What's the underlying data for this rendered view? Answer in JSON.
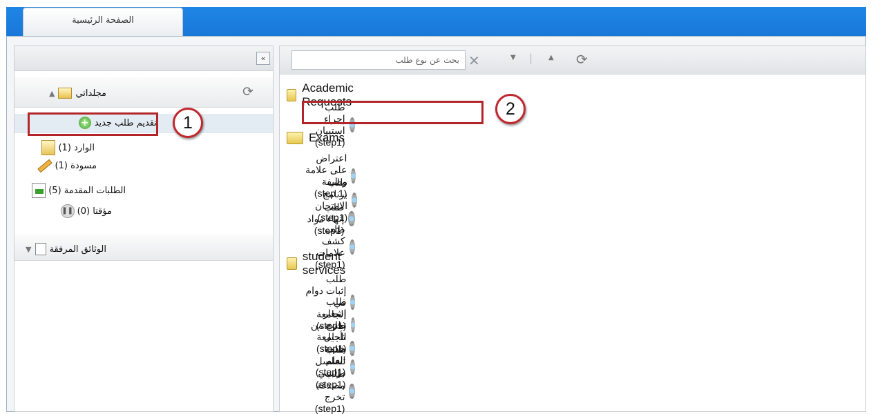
{
  "window": {
    "tab_label": "الصفحة الرئيسية"
  },
  "left_panel": {
    "collapse_glyph": "«",
    "my_folders": {
      "title": "مجلداتي",
      "items": [
        {
          "label": "تقديم طلب جديد"
        },
        {
          "label": "الوارد (1)"
        },
        {
          "label": "مسودة (1)"
        },
        {
          "label": "الطلبات المقدمة (5)"
        },
        {
          "label": "مؤقتا (0)"
        }
      ]
    },
    "attachments": {
      "title": "الوثائق المرفقة"
    }
  },
  "search": {
    "placeholder": "بحث عن نوع طلب"
  },
  "tree": {
    "folders": [
      {
        "name": "Academic Requests",
        "items": [
          "طلب إجراء استبيان (step1)"
        ]
      },
      {
        "name": "Exams",
        "items": [
          "اعتراض على علامة وظيفة (step 1)",
          "طلب برنامج الامتحان (step1)",
          "طلب إنهاء مواد (step1)",
          "طلب كشف علامات (step1)"
        ]
      },
      {
        "name": "student services",
        "items": [
          "طلب إثبات دوام في الجامعة (step1)",
          "طلب إشعار تخرج من الجامعة (step1)",
          "طلب تأجيل خدمة العلم (step1)",
          "طلب تسلسل دراسي (step1)",
          "طلب مصدقة تخرج (step1)"
        ]
      }
    ]
  },
  "callouts": {
    "one": "1",
    "two": "2"
  },
  "colors": {
    "highlight": "#b2262a",
    "topbar": "#1877d6"
  }
}
